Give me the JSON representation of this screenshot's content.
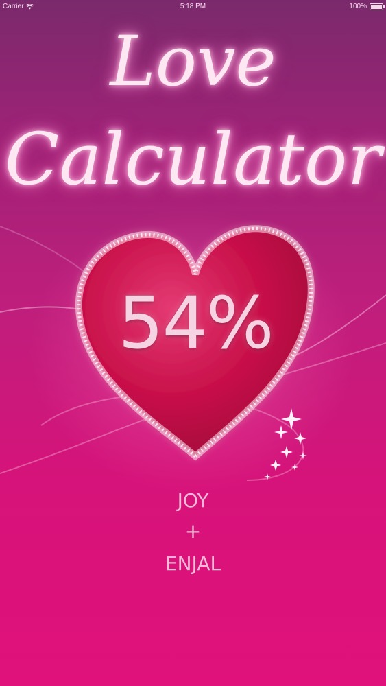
{
  "status_bar": {
    "carrier": "Carrier",
    "time": "5:18 PM",
    "battery": "100%"
  },
  "app": {
    "title_line1": "Love",
    "title_line2": "Calculator"
  },
  "result": {
    "percent": 54,
    "percent_text": "54%",
    "name1": "JOY",
    "plus": "+",
    "name2": "ENJAL"
  },
  "icons": {
    "wifi": "wifi-icon",
    "battery": "battery-icon",
    "heart": "heart-icon",
    "sparkles": "sparkles-icon"
  },
  "colors": {
    "background_top": "#7a2a6c",
    "background_bottom": "#e0117a",
    "heart_fill": "#c8104a",
    "title_glow": "#ffc8e6",
    "name_text": "#f2b9d8"
  }
}
